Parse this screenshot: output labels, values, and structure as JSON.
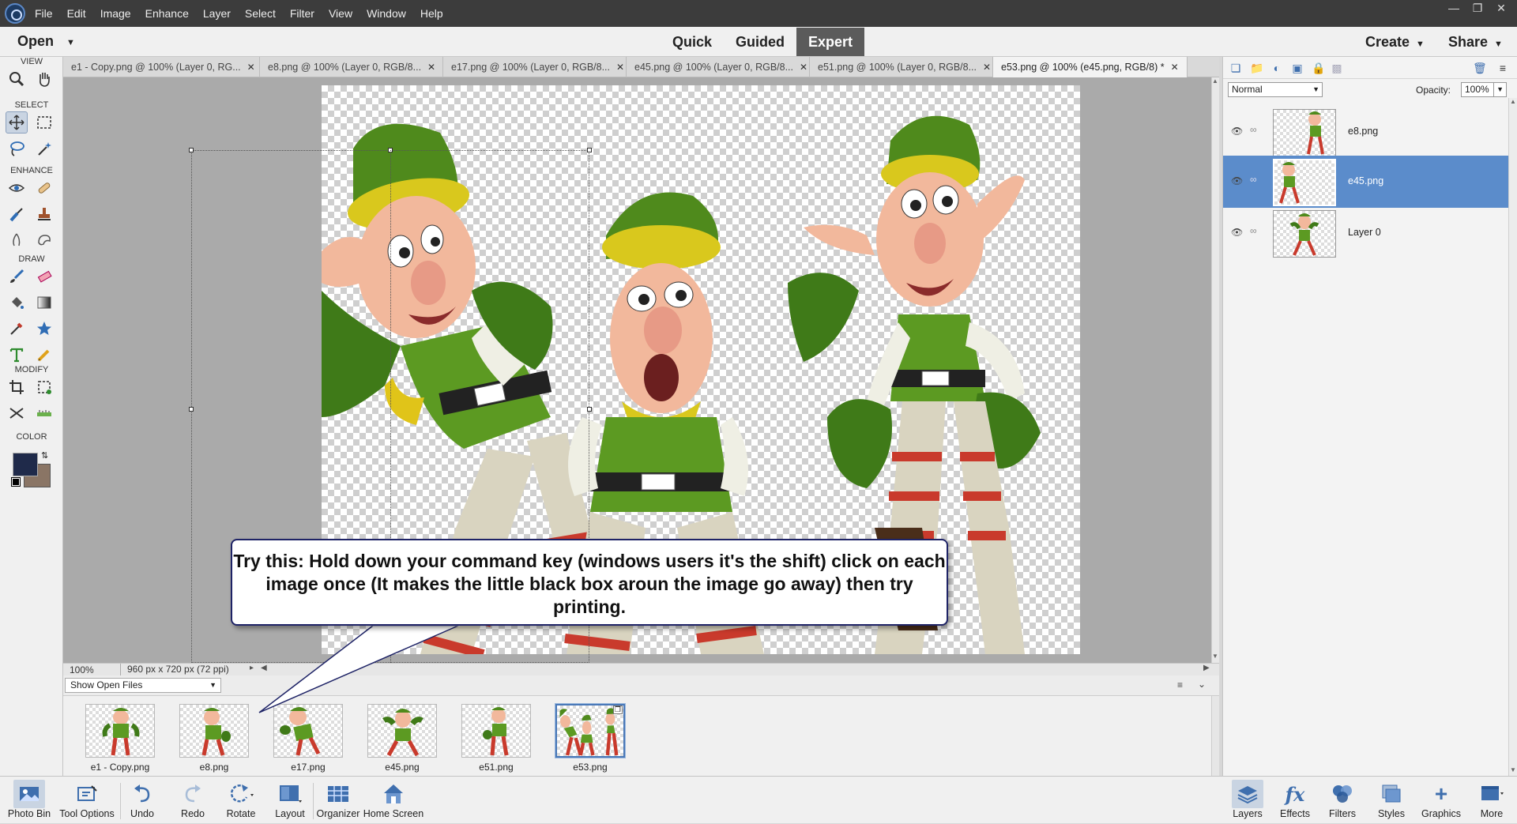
{
  "menubar": {
    "items": [
      "File",
      "Edit",
      "Image",
      "Enhance",
      "Layer",
      "Select",
      "Filter",
      "View",
      "Window",
      "Help"
    ],
    "window_controls": [
      "minimize",
      "restore",
      "close"
    ]
  },
  "modebar": {
    "open_label": "Open",
    "modes": [
      "Quick",
      "Guided",
      "Expert"
    ],
    "active_mode": "Expert",
    "create_label": "Create",
    "share_label": "Share"
  },
  "toolbox": {
    "sections": [
      "VIEW",
      "SELECT",
      "ENHANCE",
      "DRAW",
      "MODIFY",
      "COLOR"
    ],
    "tools": [
      "zoom-icon",
      "hand-icon",
      "move-icon",
      "marquee-icon",
      "lasso-icon",
      "magic-wand-icon",
      "red-eye-icon",
      "spot-healing-icon",
      "smart-brush-icon",
      "clone-stamp-icon",
      "blur-icon",
      "sponge-icon",
      "brush-icon",
      "eraser-icon",
      "paint-bucket-icon",
      "gradient-icon",
      "eyedropper-icon",
      "custom-shape-icon",
      "type-icon",
      "pencil-icon",
      "crop-icon",
      "recompose-icon",
      "content-aware-move-icon",
      "straighten-icon"
    ],
    "foreground_color": "#1f2a4a",
    "background_color": "#8a7565"
  },
  "tabs": [
    {
      "label": "e1 - Copy.png @ 100% (Layer 0, RG...",
      "active": false
    },
    {
      "label": "e8.png @ 100% (Layer 0, RGB/8...",
      "active": false
    },
    {
      "label": "e17.png @ 100% (Layer 0, RGB/8...",
      "active": false
    },
    {
      "label": "e45.png @ 100% (Layer 0, RGB/8...",
      "active": false
    },
    {
      "label": "e51.png @ 100% (Layer 0, RGB/8...",
      "active": false
    },
    {
      "label": "e53.png @ 100% (e45.png, RGB/8) *",
      "active": true
    }
  ],
  "statusbar": {
    "zoom": "100%",
    "dimensions": "960 px x 720 px (72 ppi)"
  },
  "bin": {
    "dropdown": "Show Open Files",
    "thumbnails": [
      {
        "label": "e1 - Copy.png",
        "selected": false
      },
      {
        "label": "e8.png",
        "selected": false
      },
      {
        "label": "e17.png",
        "selected": false
      },
      {
        "label": "e45.png",
        "selected": false
      },
      {
        "label": "e51.png",
        "selected": false
      },
      {
        "label": "e53.png",
        "selected": true
      }
    ]
  },
  "layers_panel": {
    "blend_mode": "Normal",
    "opacity_label": "Opacity:",
    "opacity_value": "100%",
    "layers": [
      {
        "name": "e8.png",
        "selected": false
      },
      {
        "name": "e45.png",
        "selected": true
      },
      {
        "name": "Layer 0",
        "selected": false
      }
    ]
  },
  "callout": {
    "text": "Try this: Hold down your command key (windows users it's the shift) click on each image once (It makes the little black box aroun the image go away) then try printing."
  },
  "taskbar": {
    "left": [
      "Photo Bin",
      "Tool Options",
      "Undo",
      "Redo",
      "Rotate",
      "Layout",
      "Organizer",
      "Home Screen"
    ],
    "right": [
      "Layers",
      "Effects",
      "Filters",
      "Styles",
      "Graphics",
      "More"
    ]
  },
  "colors": {
    "accent": "#5b8ccb",
    "callout_border": "#1e2366",
    "elf_green": "#4f8a1c",
    "elf_yellow": "#d9c81d"
  }
}
